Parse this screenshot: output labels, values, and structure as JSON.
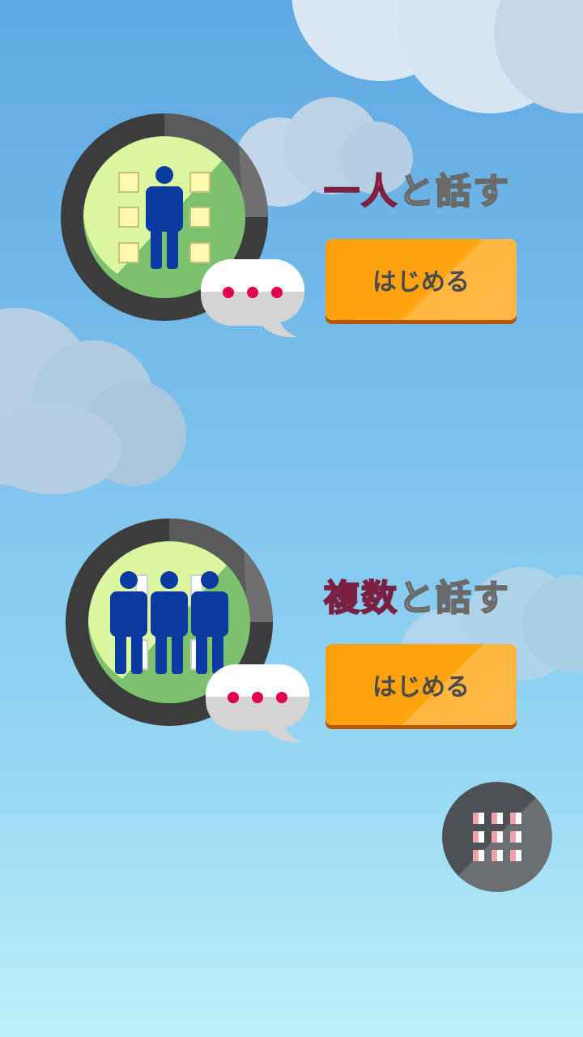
{
  "modes": [
    {
      "title_accent": "一人",
      "title_rest": "と話す",
      "button_label": "はじめる"
    },
    {
      "title_accent": "複数",
      "title_rest": "と話す",
      "button_label": "はじめる"
    }
  ],
  "menu_button": {
    "icon": "grid-icon"
  },
  "colors": {
    "accent": "#e8196a",
    "button_orange": "#ffa412",
    "figure_blue": "#0b3aa0",
    "ring_dark": "#4a4a4a",
    "inner_green": "#7cc26e",
    "inner_lime": "#ddf7a0"
  }
}
